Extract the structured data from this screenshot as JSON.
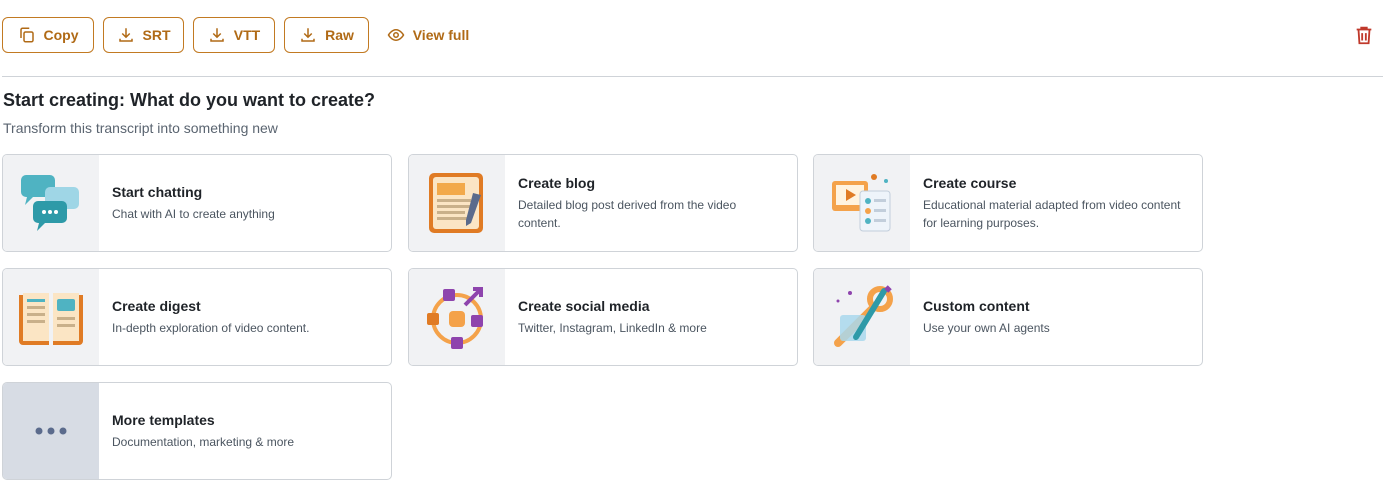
{
  "toolbar": {
    "copy_label": "Copy",
    "srt_label": "SRT",
    "vtt_label": "VTT",
    "raw_label": "Raw",
    "view_full_label": "View full"
  },
  "section": {
    "title": "Start creating: What do you want to create?",
    "subtitle": "Transform this transcript into something new"
  },
  "cards": [
    {
      "title": "Start chatting",
      "desc": "Chat with AI to create anything",
      "icon": "chat-bubbles-icon"
    },
    {
      "title": "Create blog",
      "desc": "Detailed blog post derived from the video content.",
      "icon": "blog-notepad-icon"
    },
    {
      "title": "Create course",
      "desc": "Educational material adapted from video content for learning purposes.",
      "icon": "course-board-icon"
    },
    {
      "title": "Create digest",
      "desc": "In-depth exploration of video content.",
      "icon": "open-book-icon"
    },
    {
      "title": "Create social media",
      "desc": "Twitter, Instagram, LinkedIn & more",
      "icon": "social-network-icon"
    },
    {
      "title": "Custom content",
      "desc": "Use your own AI agents",
      "icon": "tools-icon"
    },
    {
      "title": "More templates",
      "desc": "Documentation, marketing & more",
      "icon": "more-dots-icon"
    }
  ],
  "colors": {
    "accent": "#b06a16",
    "danger": "#c0392b",
    "border": "#cfd3d8"
  }
}
